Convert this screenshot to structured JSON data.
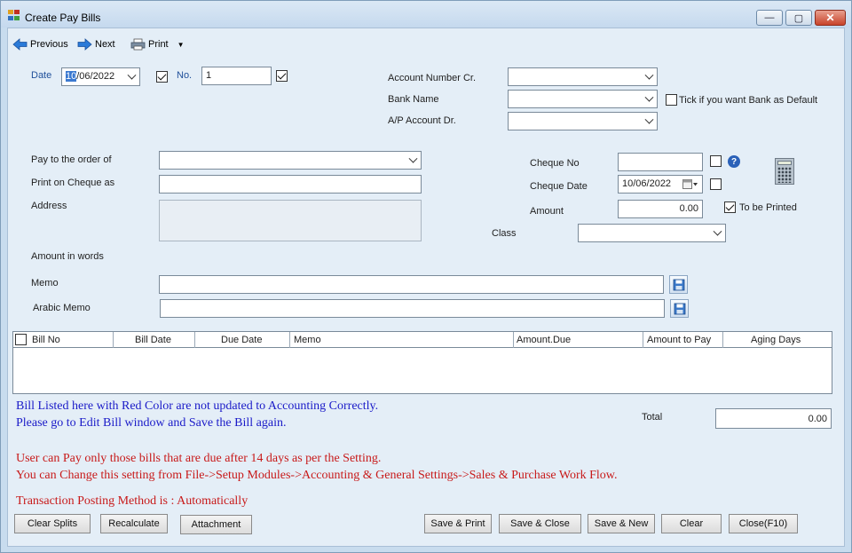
{
  "window": {
    "title": "Create Pay Bills",
    "min_glyph": "—",
    "max_glyph": "▢",
    "close_glyph": "✕"
  },
  "toolbar": {
    "previous": "Previous",
    "next": "Next",
    "print": "Print",
    "print_dropdown_glyph": "▼"
  },
  "header": {
    "date_label": "Date",
    "date_day": "10",
    "date_rest": "/06/2022",
    "date_checked": true,
    "no_label": "No.",
    "no_value": "1",
    "no_checked": true
  },
  "account": {
    "account_number_cr_label": "Account Number Cr.",
    "account_number_cr_value": "",
    "bank_name_label": "Bank Name",
    "bank_name_value": "",
    "bank_default_label": "Tick if you want Bank as Default",
    "bank_default_checked": false,
    "ap_account_dr_label": "A/P Account Dr.",
    "ap_account_dr_value": ""
  },
  "payee": {
    "pay_to_label": "Pay to the order of",
    "pay_to_value": "",
    "print_on_cheque_label": "Print on Cheque as",
    "print_on_cheque_value": "",
    "address_label": "Address",
    "amount_in_words_label": "Amount in words",
    "memo_label": "Memo",
    "memo_value": "",
    "arabic_memo_label": "Arabic Memo",
    "arabic_memo_value": ""
  },
  "cheque": {
    "cheque_no_label": "Cheque No",
    "cheque_no_value": "",
    "cheque_no_checked": false,
    "help_glyph": "?",
    "cheque_date_label": "Cheque Date",
    "cheque_date_value": "10/06/2022",
    "cheque_date_checked": false,
    "amount_label": "Amount",
    "amount_value": "0.00",
    "to_be_printed_label": "To be Printed",
    "to_be_printed_checked": true,
    "class_label": "Class",
    "class_value": ""
  },
  "grid": {
    "columns": [
      "Bill No",
      "Bill Date",
      "Due Date",
      "Memo",
      "Amount.Due",
      "Amount to Pay",
      "Aging Days"
    ],
    "rows": []
  },
  "messages": {
    "blue_line1": "Bill Listed here with Red Color are not updated to Accounting Correctly.",
    "blue_line2": "Please go to Edit Bill window and Save the Bill again.",
    "red_line1": "User can Pay only those bills that are due after 14 days as per the Setting.",
    "red_line2": "You can Change this setting from File->Setup Modules->Accounting & General Settings->Sales & Purchase Work Flow.",
    "posting_method": "Transaction Posting Method is : Automatically"
  },
  "total": {
    "label": "Total",
    "value": "0.00"
  },
  "buttons": {
    "clear_splits": "Clear Splits",
    "recalculate": "Recalculate",
    "attachment": "Attachment",
    "save_print": "Save & Print",
    "save_close": "Save & Close",
    "save_new": "Save & New",
    "clear": "Clear",
    "close": "Close(F10)"
  },
  "colors": {
    "accent_blue": "#1a1ac8",
    "warning_red": "#c81a1a",
    "selection": "#3b79d0"
  }
}
